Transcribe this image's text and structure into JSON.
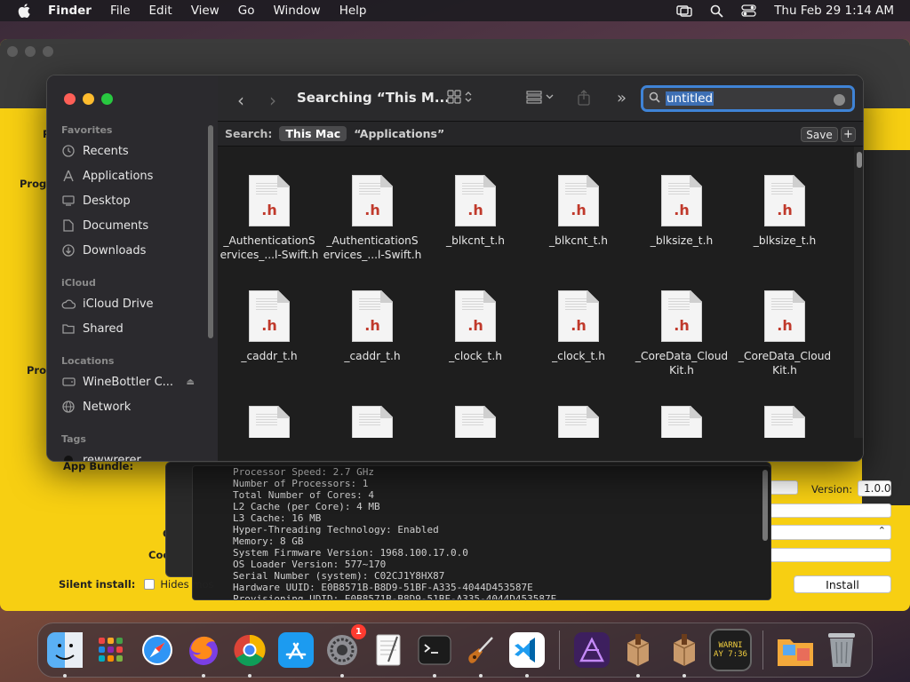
{
  "menubar": {
    "app": "Finder",
    "items": [
      "File",
      "Edit",
      "View",
      "Go",
      "Window",
      "Help"
    ],
    "clock": "Thu Feb 29  1:14 AM"
  },
  "back_window": {
    "labels": {
      "prog1": "Prog",
      "prog2": "Prog",
      "app_bundle": "App Bundle:",
      "c": "C",
      "coc": "Coc"
    },
    "version_label": "Version:",
    "version_value": "1.0.0",
    "silent_install_label": "Silent install:",
    "hides_label": "Hides mos",
    "install_button": "Install",
    "partial_text": "ve",
    "terminal_lines": [
      "Processor Speed: 2.7 GHz",
      "Number of Processors: 1",
      "Total Number of Cores: 4",
      "L2 Cache (per Core): 4 MB",
      "L3 Cache: 16 MB",
      "Hyper-Threading Technology: Enabled",
      "Memory: 8 GB",
      "System Firmware Version: 1968.100.17.0.0",
      "OS Loader Version: 577~170",
      "Serial Number (system): C02CJ1Y8HX87",
      "Hardware UUID: E0B8571B-B8D9-51BF-A335-4044D453587E",
      "Provisioning UDID: E0B8571B-B8D9-51BF-A335-4044D453587E"
    ]
  },
  "finder": {
    "title": "Searching “This M...",
    "search": {
      "value": "untitled"
    },
    "scope": {
      "label": "Search:",
      "this_mac": "This Mac",
      "applications": "“Applications”",
      "save": "Save",
      "plus": "+"
    },
    "sidebar": {
      "favorites": "Favorites",
      "icloud": "iCloud",
      "locations": "Locations",
      "tags": "Tags",
      "items": [
        {
          "label": "Recents",
          "icon": "clock-icon"
        },
        {
          "label": "Applications",
          "icon": "applications-icon"
        },
        {
          "label": "Desktop",
          "icon": "desktop-icon"
        },
        {
          "label": "Documents",
          "icon": "document-icon"
        },
        {
          "label": "Downloads",
          "icon": "download-icon"
        },
        {
          "label": "iCloud Drive",
          "icon": "cloud-icon"
        },
        {
          "label": "Shared",
          "icon": "shared-folder-icon"
        },
        {
          "label": "WineBottler C...",
          "icon": "disk-icon"
        },
        {
          "label": "Network",
          "icon": "network-icon"
        },
        {
          "label": "rewwrerer",
          "icon": "tag-icon"
        }
      ]
    },
    "file_ext": ".h",
    "files": [
      {
        "name": "_AuthenticationServices_...l-Swift.h",
        "l1": "_AuthenticationS",
        "l2": "ervices_...l-Swift.h"
      },
      {
        "name": "_AuthenticationServices_...l-Swift.h",
        "l1": "_AuthenticationS",
        "l2": "ervices_...l-Swift.h"
      },
      {
        "name": "_blkcnt_t.h",
        "l1": "_blkcnt_t.h",
        "l2": ""
      },
      {
        "name": "_blkcnt_t.h",
        "l1": "_blkcnt_t.h",
        "l2": ""
      },
      {
        "name": "_blksize_t.h",
        "l1": "_blksize_t.h",
        "l2": ""
      },
      {
        "name": "_blksize_t.h",
        "l1": "_blksize_t.h",
        "l2": ""
      },
      {
        "name": "_caddr_t.h",
        "l1": "_caddr_t.h",
        "l2": ""
      },
      {
        "name": "_caddr_t.h",
        "l1": "_caddr_t.h",
        "l2": ""
      },
      {
        "name": "_clock_t.h",
        "l1": "_clock_t.h",
        "l2": ""
      },
      {
        "name": "_clock_t.h",
        "l1": "_clock_t.h",
        "l2": ""
      },
      {
        "name": "_CoreData_CloudKit.h",
        "l1": "_CoreData_Cloud",
        "l2": "Kit.h"
      },
      {
        "name": "_CoreData_CloudKit.h",
        "l1": "_CoreData_Cloud",
        "l2": "Kit.h"
      }
    ]
  },
  "dock": {
    "apps": [
      {
        "name": "finder-icon",
        "color": "#3b8ef0"
      },
      {
        "name": "launchpad-icon",
        "color": "#e8e8e8"
      },
      {
        "name": "safari-icon",
        "color": "#1d8ff2"
      },
      {
        "name": "firefox-icon",
        "color": "#ff7a1a"
      },
      {
        "name": "chrome-icon",
        "color": "#ffffff"
      },
      {
        "name": "app-store-icon",
        "color": "#1c9bf0"
      },
      {
        "name": "system-settings-icon",
        "color": "#8e8e93"
      },
      {
        "name": "textedit-icon",
        "color": "#f4f4f4"
      },
      {
        "name": "terminal-icon",
        "color": "#1a1a1a"
      },
      {
        "name": "garageband-icon",
        "color": "#333"
      },
      {
        "name": "vscode-icon",
        "color": "#ffffff"
      }
    ],
    "settings_badge": "1",
    "warning_text": "WARNI",
    "warning_time": "AY 7:36"
  }
}
